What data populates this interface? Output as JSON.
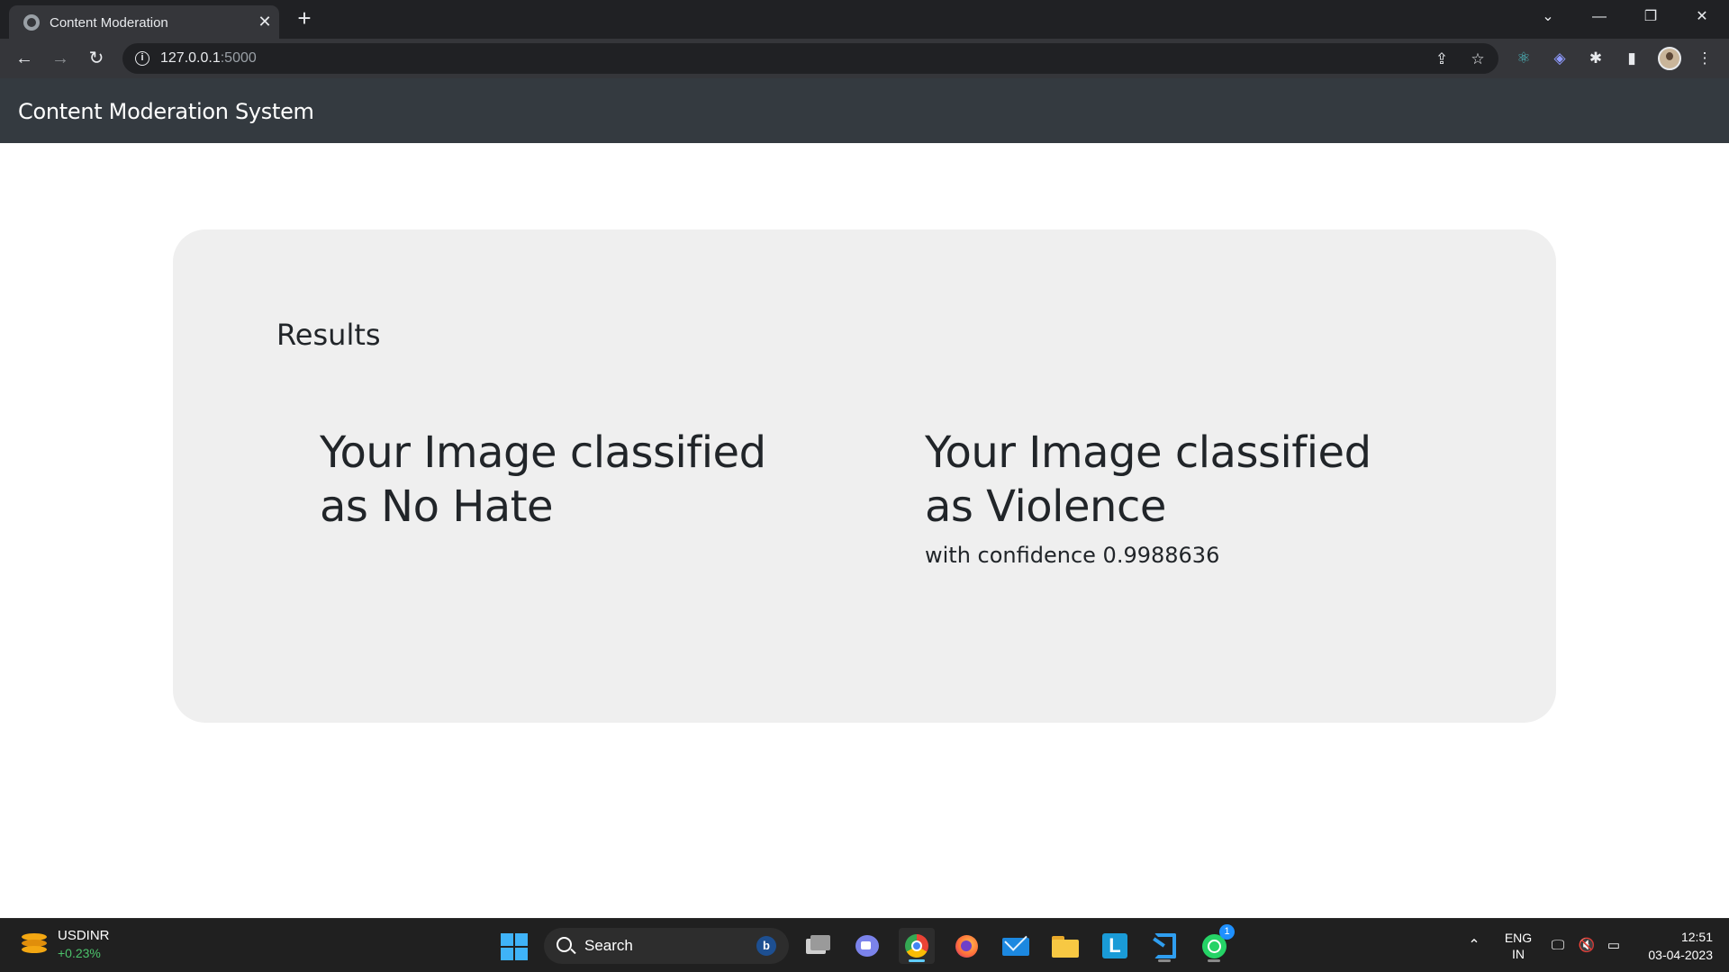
{
  "browser": {
    "tab_title": "Content Moderation",
    "url_host": "127.0.0.1",
    "url_port": ":5000"
  },
  "navbar": {
    "brand": "Content Moderation System"
  },
  "results": {
    "heading": "Results",
    "hate_line1": "Your Image classified",
    "hate_line2": "as No Hate",
    "violence_line1": "Your Image classified",
    "violence_line2": "as Violence",
    "violence_confidence": "with confidence 0.9988636"
  },
  "taskbar": {
    "ticker_name": "USDINR",
    "ticker_change": "+0.23%",
    "search_label": "Search",
    "whatsapp_badge": "1",
    "lang_line1": "ENG",
    "lang_line2": "IN",
    "time": "12:51",
    "date": "03-04-2023"
  },
  "colors": {
    "navbar_bg": "#343a40",
    "card_bg": "#efefef",
    "ticker_up": "#4cc26b"
  }
}
